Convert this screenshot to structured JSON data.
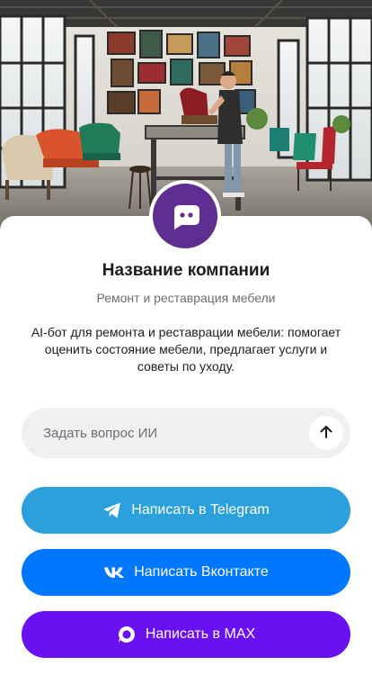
{
  "company": {
    "name": "Название компании",
    "subtitle": "Ремонт и реставрация мебели",
    "description": "AI-бот для ремонта и реставрации мебели: помогает оценить состояние мебели, предлагает услуги и советы по уходу."
  },
  "ask": {
    "placeholder": "Задать вопрос ИИ"
  },
  "buttons": {
    "telegram": "Написать в Telegram",
    "vk": "Написать Вконтакте",
    "max": "Написать в MAX"
  },
  "colors": {
    "avatar": "#5e2e91",
    "telegram": "#2aa0dc",
    "vk": "#0077ff",
    "max": "#6a11f4"
  },
  "icons": {
    "avatar": "chat-bot-icon",
    "send": "arrow-up-icon",
    "telegram": "telegram-icon",
    "vk": "vk-icon",
    "max": "max-icon"
  }
}
